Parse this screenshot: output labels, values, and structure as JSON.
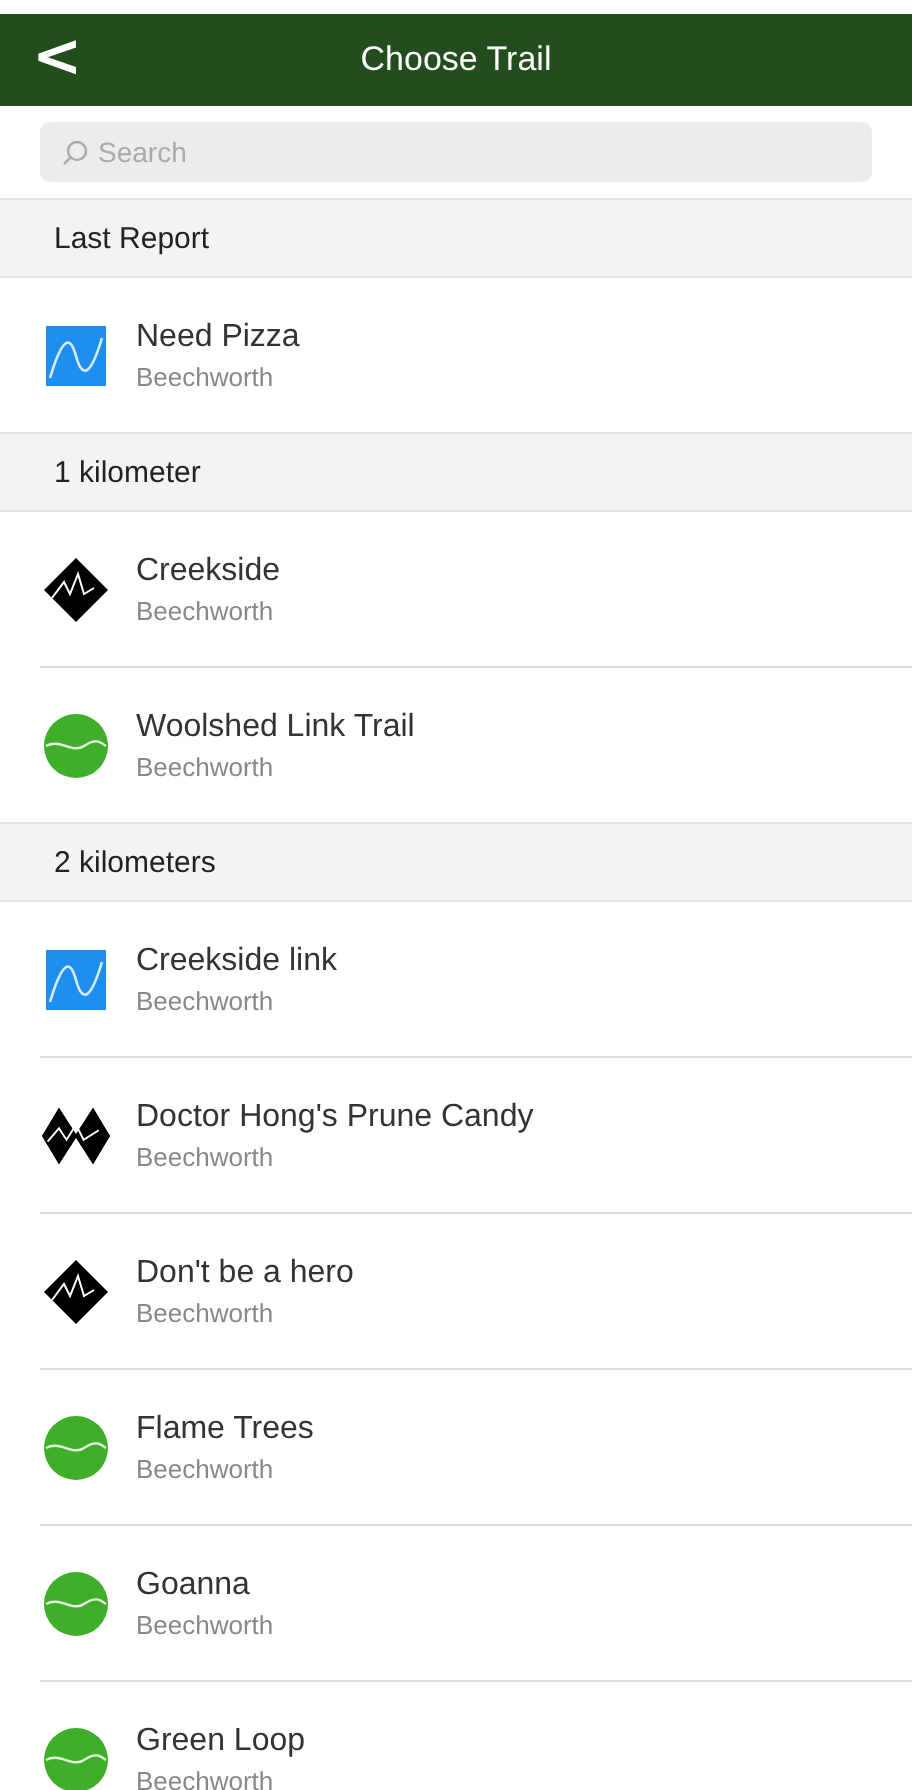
{
  "nav": {
    "back": "<",
    "title": "Choose Trail"
  },
  "search": {
    "placeholder": "Search"
  },
  "sections": [
    {
      "title": "Last Report",
      "trails": [
        {
          "name": "Need Pizza",
          "location": "Beechworth",
          "kind": "blue_square"
        }
      ]
    },
    {
      "title": "1 kilometer",
      "trails": [
        {
          "name": "Creekside",
          "location": "Beechworth",
          "kind": "black_diamond"
        },
        {
          "name": "Woolshed Link Trail",
          "location": "Beechworth",
          "kind": "green_circle"
        }
      ]
    },
    {
      "title": "2 kilometers",
      "trails": [
        {
          "name": "Creekside link",
          "location": "Beechworth",
          "kind": "blue_square"
        },
        {
          "name": "Doctor Hong's Prune Candy",
          "location": "Beechworth",
          "kind": "double_black"
        },
        {
          "name": "Don't be a hero",
          "location": "Beechworth",
          "kind": "black_diamond"
        },
        {
          "name": "Flame Trees",
          "location": "Beechworth",
          "kind": "green_circle"
        },
        {
          "name": "Goanna",
          "location": "Beechworth",
          "kind": "green_circle"
        },
        {
          "name": "Green Loop",
          "location": "Beechworth",
          "kind": "green_circle"
        }
      ]
    }
  ]
}
